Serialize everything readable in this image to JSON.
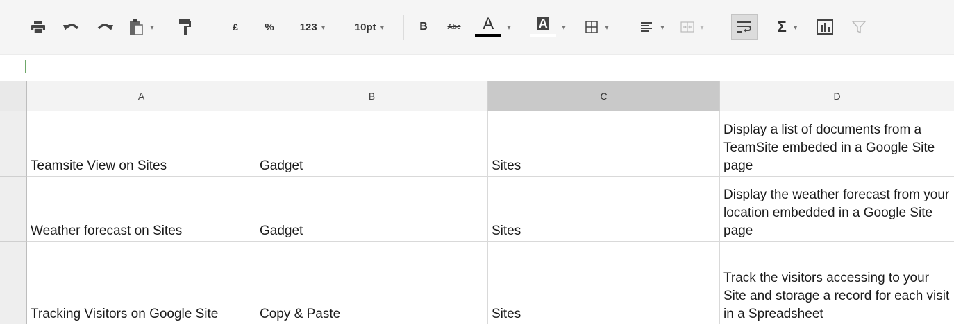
{
  "toolbar": {
    "currency_label": "£",
    "percent_label": "%",
    "number_format_label": "123",
    "font_size_label": "10pt",
    "bold_label": "B",
    "strikethrough_label": "Abc",
    "text_color_label": "A",
    "fill_color_label": "A",
    "text_color": "#000000",
    "fill_color": "#ffffff",
    "icons": [
      "print-icon",
      "undo-icon",
      "redo-icon",
      "paste-icon",
      "paint-format-icon",
      "borders-icon",
      "align-left-icon",
      "merge-cells-icon",
      "wrap-text-icon",
      "sum-icon",
      "chart-icon",
      "filter-icon"
    ]
  },
  "columns": [
    "A",
    "B",
    "C",
    "D"
  ],
  "selected_column": "C",
  "rows": [
    {
      "a": "Teamsite View on Sites",
      "b": "Gadget",
      "c": "Sites",
      "d": "Display a list of documents from a TeamSite embeded in a Google Site page"
    },
    {
      "a": "Weather forecast on Sites",
      "b": "Gadget",
      "c": "Sites",
      "d": "Display the weather forecast from your location embedded in a Google Site page"
    },
    {
      "a": "Tracking Visitors on Google Site",
      "b": "Copy & Paste",
      "c": "Sites",
      "d": "Track the visitors accessing to your Site and storage a record for each visit in a Spreadsheet"
    }
  ]
}
